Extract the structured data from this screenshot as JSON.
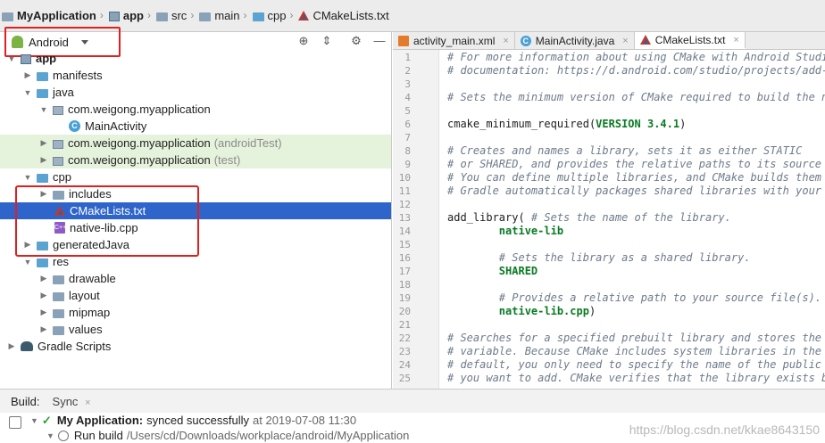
{
  "breadcrumb": {
    "items": [
      "MyApplication",
      "app",
      "src",
      "main",
      "cpp",
      "CMakeLists.txt"
    ]
  },
  "project_panel": {
    "view_mode": "Android",
    "toolbar_icons": [
      "locate-icon",
      "collapse-all-icon",
      "settings-gear-icon",
      "hide-panel-icon"
    ],
    "tree": [
      {
        "label": "app",
        "bold": true
      },
      {
        "label": "manifests"
      },
      {
        "label": "java"
      },
      {
        "label": "com.weigong.myapplication"
      },
      {
        "label": "MainActivity"
      },
      {
        "label": "com.weigong.myapplication",
        "suffix": "(androidTest)"
      },
      {
        "label": "com.weigong.myapplication",
        "suffix": "(test)"
      },
      {
        "label": "cpp"
      },
      {
        "label": "includes"
      },
      {
        "label": "CMakeLists.txt"
      },
      {
        "label": "native-lib.cpp"
      },
      {
        "label": "generatedJava"
      },
      {
        "label": "res"
      },
      {
        "label": "drawable"
      },
      {
        "label": "layout"
      },
      {
        "label": "mipmap"
      },
      {
        "label": "values"
      },
      {
        "label": "Gradle Scripts"
      }
    ]
  },
  "editor": {
    "tabs": [
      {
        "label": "activity_main.xml"
      },
      {
        "label": "MainActivity.java"
      },
      {
        "label": "CMakeLists.txt"
      }
    ],
    "active_tab": "CMakeLists.txt",
    "lines": [
      {
        "n": "1",
        "text": "# For more information about using CMake with Android Studio,",
        "kind": "comment"
      },
      {
        "n": "2",
        "text": "# documentation: https://d.android.com/studio/projects/add-na",
        "kind": "comment"
      },
      {
        "n": "3",
        "text": "",
        "kind": "plain"
      },
      {
        "n": "4",
        "text": "# Sets the minimum version of CMake required to build the nat",
        "kind": "comment"
      },
      {
        "n": "5",
        "text": "",
        "kind": "plain"
      },
      {
        "n": "6",
        "pre": "cmake_minimum_required(",
        "kw": "VERSION 3.4.1",
        "post": ")",
        "kind": "mixed"
      },
      {
        "n": "7",
        "text": "",
        "kind": "plain"
      },
      {
        "n": "8",
        "text": "# Creates and names a library, sets it as either STATIC",
        "kind": "comment"
      },
      {
        "n": "9",
        "text": "# or SHARED, and provides the relative paths to its source co",
        "kind": "comment"
      },
      {
        "n": "10",
        "text": "# You can define multiple libraries, and CMake builds them fo",
        "kind": "comment"
      },
      {
        "n": "11",
        "text": "# Gradle automatically packages shared libraries with your AP",
        "kind": "comment"
      },
      {
        "n": "12",
        "text": "",
        "kind": "plain"
      },
      {
        "n": "13",
        "pre": "add_library( ",
        "comment": "# Sets the name of the library.",
        "kind": "mixed-comment"
      },
      {
        "n": "14",
        "text": "        native-lib",
        "kind": "keyword"
      },
      {
        "n": "15",
        "text": "",
        "kind": "plain"
      },
      {
        "n": "16",
        "text": "        # Sets the library as a shared library.",
        "kind": "comment"
      },
      {
        "n": "17",
        "text": "        SHARED",
        "kind": "keyword"
      },
      {
        "n": "18",
        "text": "",
        "kind": "plain"
      },
      {
        "n": "19",
        "text": "        # Provides a relative path to your source file(s).",
        "kind": "comment"
      },
      {
        "n": "20",
        "pre": "        ",
        "kw": "native-lib.cpp",
        "post": ")",
        "kind": "mixed"
      },
      {
        "n": "21",
        "text": "",
        "kind": "plain"
      },
      {
        "n": "22",
        "text": "# Searches for a specified prebuilt library and stores the pa",
        "kind": "comment"
      },
      {
        "n": "23",
        "text": "# variable. Because CMake includes system libraries in the se",
        "kind": "comment"
      },
      {
        "n": "24",
        "text": "# default, you only need to specify the name of the public ND",
        "kind": "comment"
      },
      {
        "n": "25",
        "text": "# you want to add. CMake verifies that the library exists bef",
        "kind": "comment"
      }
    ]
  },
  "build_panel": {
    "tab_label": "Build:",
    "sync_tab": "Sync",
    "status_title": "My Application:",
    "status_text": "synced successfully",
    "status_time": "at 2019-07-08 11:30",
    "run_build_label": "Run build",
    "run_build_path": "/Users/cd/Downloads/workplace/android/MyApplication",
    "watermark": "https://blog.csdn.net/kkae8643150"
  }
}
